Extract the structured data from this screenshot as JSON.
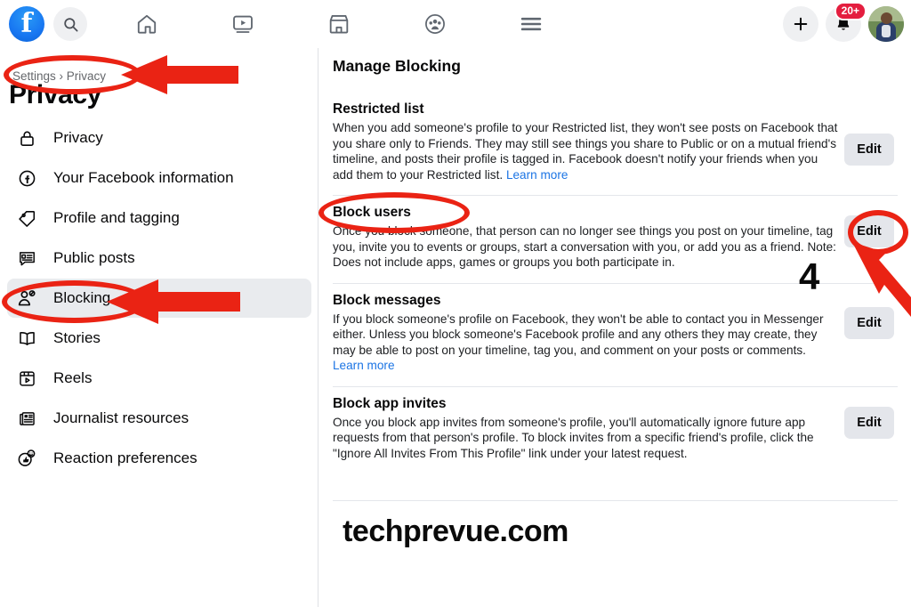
{
  "topbar": {
    "logo_label": "f",
    "search_icon": "search-icon",
    "nav_icons": [
      {
        "name": "home-icon",
        "label": "Home"
      },
      {
        "name": "video-icon",
        "label": "Video"
      },
      {
        "name": "marketplace-icon",
        "label": "Marketplace"
      },
      {
        "name": "groups-icon",
        "label": "Groups"
      },
      {
        "name": "menu-icon",
        "label": "Menu"
      }
    ],
    "create_icon": "plus-icon",
    "notifications_icon": "bell-icon",
    "notifications_badge": "20+",
    "avatar": "profile-avatar"
  },
  "sidebar": {
    "breadcrumb": "Settings › Privacy",
    "title": "Privacy",
    "items": [
      {
        "label": "Privacy",
        "icon": "lock-icon",
        "active": false
      },
      {
        "label": "Your Facebook information",
        "icon": "facebook-circle-icon",
        "active": false
      },
      {
        "label": "Profile and tagging",
        "icon": "tag-icon",
        "active": false
      },
      {
        "label": "Public posts",
        "icon": "comment-list-icon",
        "active": false
      },
      {
        "label": "Blocking",
        "icon": "blocked-user-icon",
        "active": true
      },
      {
        "label": "Stories",
        "icon": "book-icon",
        "active": false
      },
      {
        "label": "Reels",
        "icon": "reels-play-icon",
        "active": false
      },
      {
        "label": "Journalist resources",
        "icon": "newspaper-icon",
        "active": false
      },
      {
        "label": "Reaction preferences",
        "icon": "thumbs-up-emoji-icon",
        "active": false
      }
    ]
  },
  "main": {
    "title": "Manage Blocking",
    "edit_label": "Edit",
    "sections": [
      {
        "heading": "Restricted list",
        "body": "When you add someone's profile to your Restricted list, they won't see posts on Facebook that you share only to Friends. They may still see things you share to Public or on a mutual friend's timeline, and posts their profile is tagged in. Facebook doesn't notify your friends when you add them to your Restricted list. ",
        "link": "Learn more"
      },
      {
        "heading": "Block users",
        "body": "Once you block someone, that person can no longer see things you post on your timeline, tag you, invite you to events or groups, start a conversation with you, or add you as a friend. Note: Does not include apps, games or groups you both participate in.",
        "link": ""
      },
      {
        "heading": "Block messages",
        "body": "If you block someone's profile on Facebook, they won't be able to contact you in Messenger either. Unless you block someone's Facebook profile and any others they may create, they may be able to post on your timeline, tag you, and comment on your posts or comments. ",
        "link": "Learn more"
      },
      {
        "heading": "Block app invites",
        "body": "Once you block app invites from someone's profile, you'll automatically ignore future app requests from that person's profile. To block invites from a specific friend's profile, click the \"Ignore All Invites From This Profile\" link under your latest request.",
        "link": ""
      }
    ]
  },
  "annotations": {
    "step_number": "4",
    "highlight_color": "#ea2314"
  },
  "watermark": "techprevue.com"
}
